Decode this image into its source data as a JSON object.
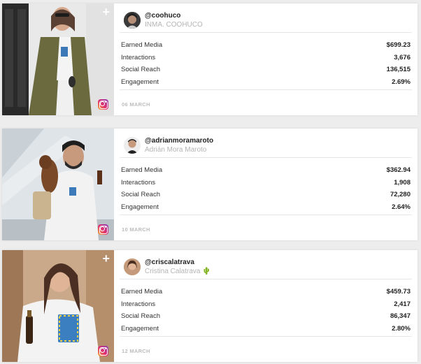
{
  "posts": [
    {
      "handle": "@coohuco",
      "name": "INMA. COOHUCO",
      "metrics": [
        {
          "label": "Earned Media",
          "value": "$699.23"
        },
        {
          "label": "Interactions",
          "value": "3,676"
        },
        {
          "label": "Social Reach",
          "value": "136,515"
        },
        {
          "label": "Engagement",
          "value": "2.69%"
        }
      ],
      "date": "06 MARCH",
      "platform_icon": "instagram-icon",
      "plus_glyph": "+"
    },
    {
      "handle": "@adrianmoramaroto",
      "name": "Adrián Mora Maroto",
      "metrics": [
        {
          "label": "Earned Media",
          "value": "$362.94"
        },
        {
          "label": "Interactions",
          "value": "1,908"
        },
        {
          "label": "Social Reach",
          "value": "72,280"
        },
        {
          "label": "Engagement",
          "value": "2.64%"
        }
      ],
      "date": "10 MARCH",
      "platform_icon": "instagram-icon",
      "plus_glyph": "+"
    },
    {
      "handle": "@criscalatrava",
      "name": "Cristina Calatrava 🌵",
      "metrics": [
        {
          "label": "Earned Media",
          "value": "$459.73"
        },
        {
          "label": "Interactions",
          "value": "2,417"
        },
        {
          "label": "Social Reach",
          "value": "86,347"
        },
        {
          "label": "Engagement",
          "value": "2.80%"
        }
      ],
      "date": "12 MARCH",
      "platform_icon": "instagram-icon",
      "plus_glyph": "+"
    }
  ],
  "colors": {
    "background": "#ededed",
    "card": "#ffffff",
    "muted_text": "#b4b4b4",
    "date_text": "#bdbdbd"
  }
}
